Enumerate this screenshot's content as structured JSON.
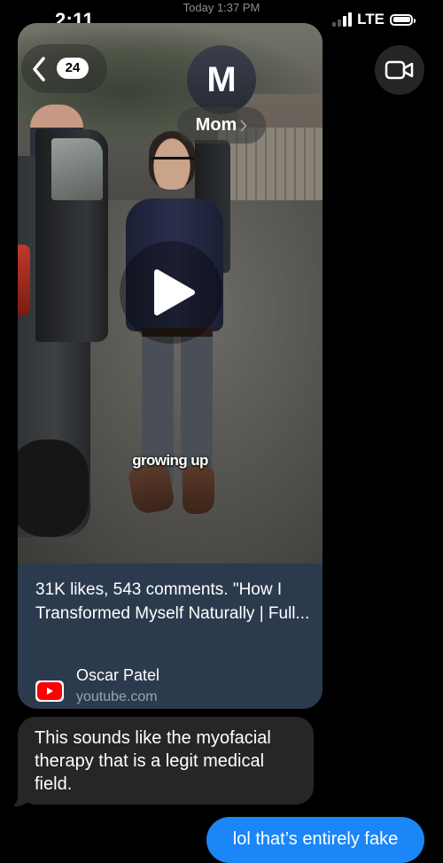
{
  "status_bar": {
    "time": "2:11",
    "today_label": "Today 1:37 PM",
    "network": "LTE",
    "signal_bars_active": 2,
    "signal_bars_total": 4,
    "battery_level": 1.0
  },
  "header": {
    "back_count": "24",
    "contact_initial": "M",
    "contact_name": "Mom"
  },
  "video_card": {
    "caption": "growing up",
    "link_title": "31K likes, 543 comments. \"How I Transformed Myself Naturally | Full...",
    "channel": "Oscar Patel",
    "domain": "youtube.com",
    "card_color": "#2c3a4e"
  },
  "messages": [
    {
      "side": "received",
      "text": "This sounds like the myofacial therapy that is a legit medical field.",
      "color": "#262628"
    },
    {
      "side": "sent",
      "text": "lol that’s entirely fake",
      "color": "#1a86f7"
    }
  ],
  "icons": {
    "back": "chevron-left-icon",
    "video_call": "video-camera-icon",
    "play": "play-icon",
    "youtube": "youtube-logo-icon",
    "name_chevron": "chevron-right-icon"
  }
}
